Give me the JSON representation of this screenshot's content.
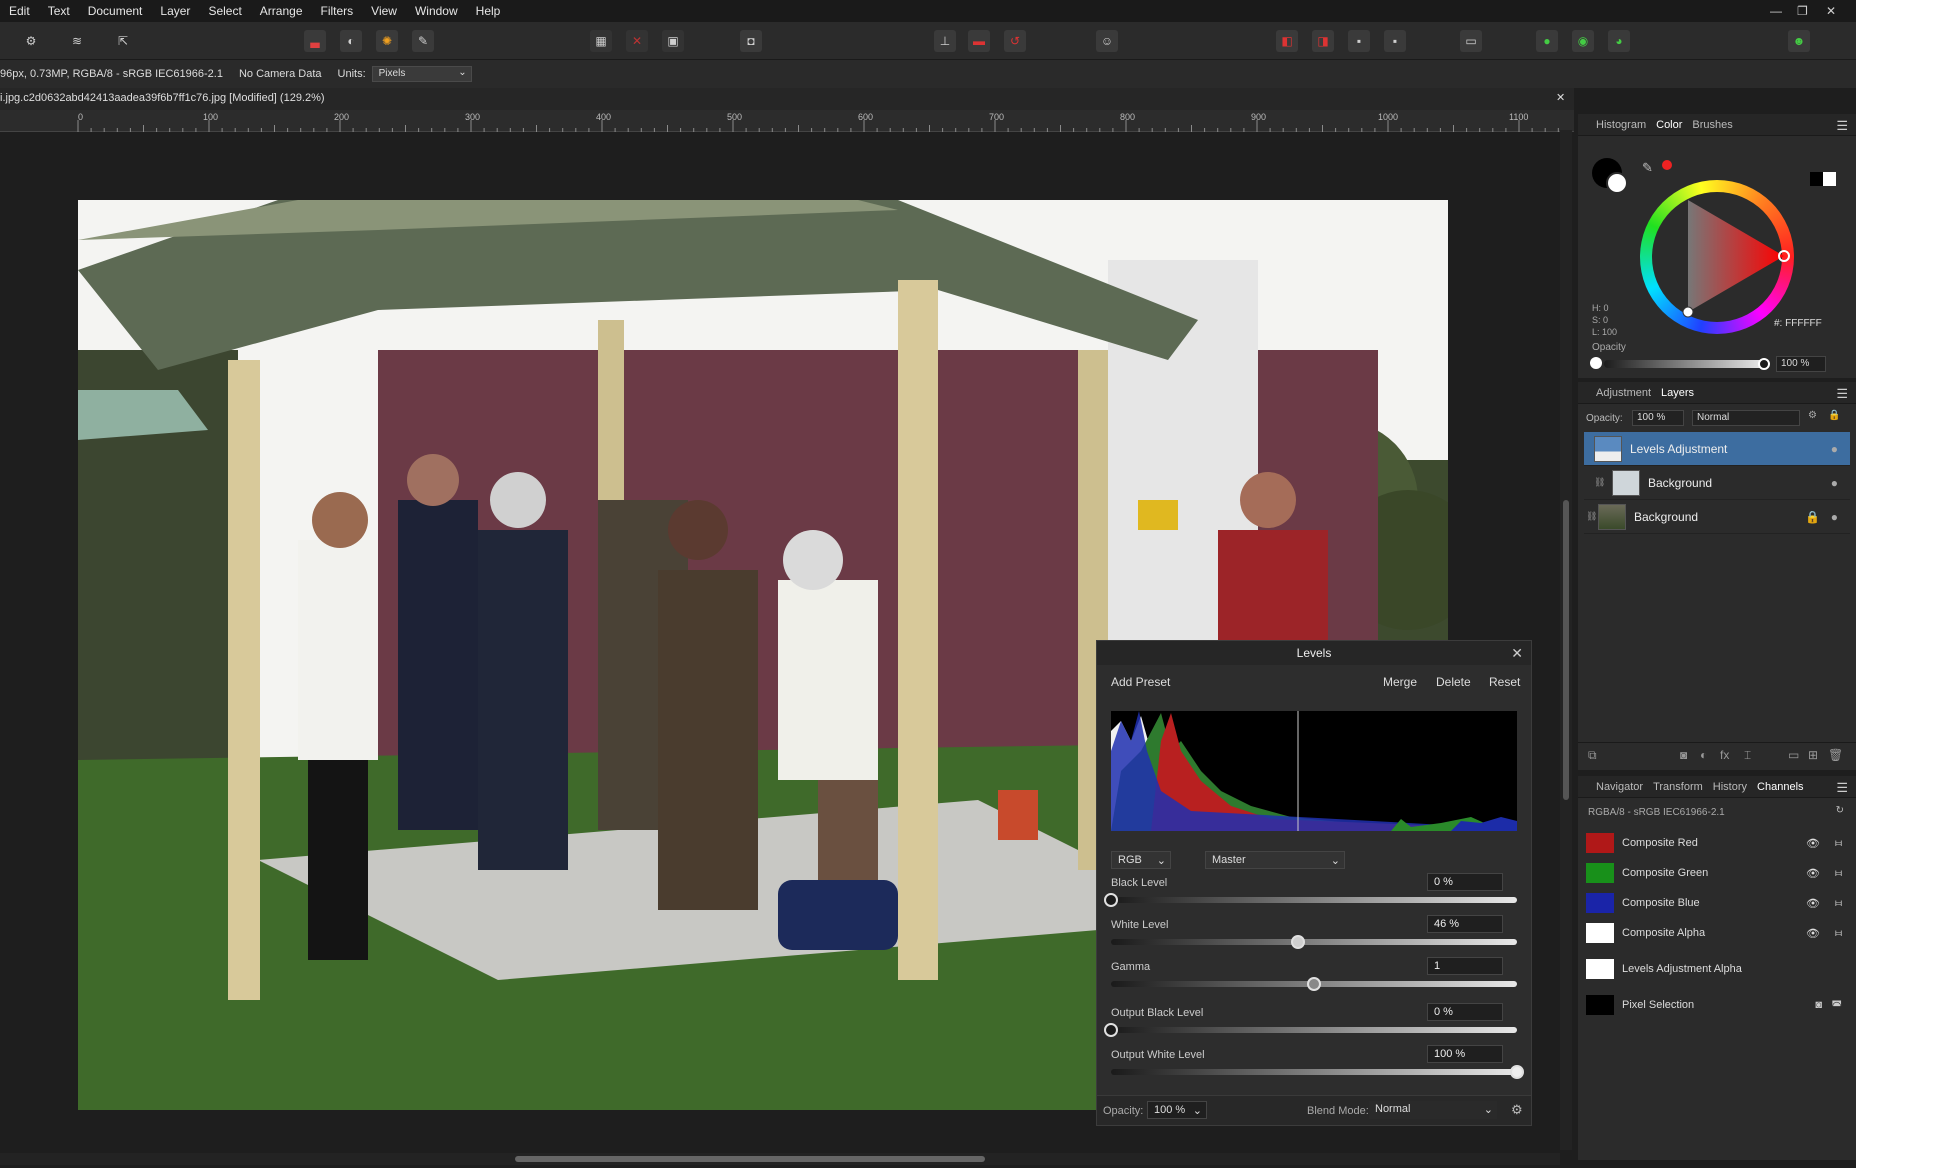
{
  "menu": [
    "Edit",
    "Text",
    "Document",
    "Layer",
    "Select",
    "Arrange",
    "Filters",
    "View",
    "Window",
    "Help"
  ],
  "window_controls": {
    "min": "—",
    "max": "❐",
    "close": "✕"
  },
  "toolbar_icons": [
    "persona-photo-icon",
    "persona-liquify-icon",
    "persona-export-icon",
    "histogram-icon",
    "halftone-icon",
    "color-wheel-icon",
    "brush-icon",
    "marquee-icon",
    "deselect-icon",
    "invert-selection-icon",
    "quickmask-icon",
    "align-icon",
    "flip-icon",
    "rotate-icon",
    "assistant-icon",
    "arrange-icon",
    "boolean-icon",
    "snapping-icon",
    "account-icon"
  ],
  "context": {
    "info": "96px, 0.73MP, RGBA/8 - sRGB IEC61966-2.1",
    "camera": "No Camera Data",
    "units_label": "Units:",
    "units_value": "Pixels"
  },
  "doc_tab": {
    "title": "i.jpg.c2d0632abd42413aadea39f6b7ff1c76.jpg [Modified] (129.2%)",
    "close": "✕"
  },
  "ruler_labels": [
    "0",
    "100",
    "200",
    "300",
    "400",
    "500",
    "600",
    "700",
    "800",
    "900",
    "1000",
    "1100"
  ],
  "color_panel": {
    "tabs": [
      "Histogram",
      "Color",
      "Brushes"
    ],
    "active_tab": "Color",
    "hsl": [
      "H: 0",
      "S: 0",
      "L: 100"
    ],
    "hex": "FFFFFF",
    "opacity_label": "Opacity",
    "opacity_value": "100 %"
  },
  "layers_panel": {
    "tabs": [
      "Adjustment",
      "Layers"
    ],
    "active_tab": "Layers",
    "opacity_label": "Opacity:",
    "opacity_value": "100 %",
    "blend_mode": "Normal",
    "layers": [
      {
        "name": "Levels Adjustment",
        "selected": true
      },
      {
        "name": "Background",
        "selected": false
      },
      {
        "name": "Background",
        "selected": false
      }
    ]
  },
  "channels_panel": {
    "tabs": [
      "Navigator",
      "Transform",
      "History",
      "Channels"
    ],
    "active_tab": "Channels",
    "profile": "RGBA/8 - sRGB IEC61966-2.1",
    "channels": [
      {
        "name": "Composite Red",
        "color": "#c01818"
      },
      {
        "name": "Composite Green",
        "color": "#18a018"
      },
      {
        "name": "Composite Blue",
        "color": "#1c2cb8"
      },
      {
        "name": "Composite Alpha",
        "color": "#ffffff"
      },
      {
        "name": "Levels Adjustment Alpha",
        "color": "#ffffff"
      },
      {
        "name": "Pixel Selection",
        "color": "#000000"
      }
    ]
  },
  "levels": {
    "title": "Levels",
    "add_preset": "Add Preset",
    "merge": "Merge",
    "delete": "Delete",
    "reset": "Reset",
    "channel_mode": "RGB",
    "channel": "Master",
    "black_level_label": "Black Level",
    "black_level": "0 %",
    "white_level_label": "White Level",
    "white_level": "46 %",
    "gamma_label": "Gamma",
    "gamma": "1",
    "output_black_label": "Output Black Level",
    "output_black": "0 %",
    "output_white_label": "Output White Level",
    "output_white": "100 %",
    "opacity_label": "Opacity:",
    "opacity": "100 %",
    "blend_label": "Blend Mode:",
    "blend": "Normal",
    "black_frac": 0.0,
    "white_frac": 0.46,
    "gamma_frac": 0.5,
    "out_black_frac": 0.0,
    "out_white_frac": 1.0
  }
}
